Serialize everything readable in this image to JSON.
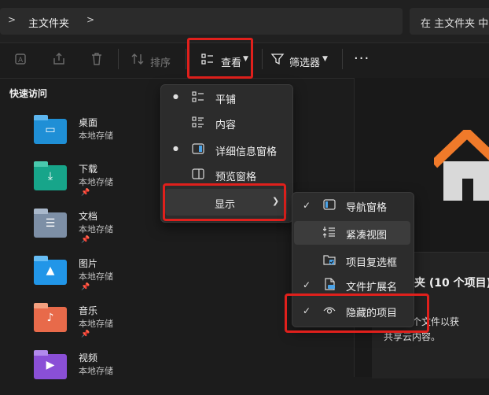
{
  "address": {
    "path_label": "主文件夹",
    "chevron": ">"
  },
  "search": {
    "placeholder": "在 主文件夹 中"
  },
  "toolbar": {
    "sort_label": "排序",
    "view_label": "查看",
    "filter_label": "筛选器",
    "more_label": "···",
    "highlight_color": "#e0201c"
  },
  "sidebar": {
    "title": "快速访问",
    "items": [
      {
        "name": "桌面",
        "sub": "本地存储",
        "color": "#1f8fd6",
        "icon": "desktop-folder-icon"
      },
      {
        "name": "下载",
        "sub": "本地存储",
        "color": "#17a58a",
        "icon": "download-folder-icon"
      },
      {
        "name": "文档",
        "sub": "本地存储",
        "color": "#7d8fa6",
        "icon": "documents-folder-icon"
      },
      {
        "name": "图片",
        "sub": "本地存储",
        "color": "#2196e8",
        "icon": "pictures-folder-icon"
      },
      {
        "name": "音乐",
        "sub": "本地存储",
        "color": "#e86a4a",
        "icon": "music-folder-icon"
      },
      {
        "name": "视频",
        "sub": "本地存储",
        "color": "#8a4fd6",
        "icon": "videos-folder-icon"
      }
    ]
  },
  "view_menu": {
    "items": [
      {
        "label": "平铺",
        "selected": true,
        "icon": "tiles-icon"
      },
      {
        "label": "内容",
        "selected": false,
        "icon": "content-icon"
      },
      {
        "label": "详细信息窗格",
        "selected": true,
        "icon": "details-pane-icon"
      },
      {
        "label": "预览窗格",
        "selected": false,
        "icon": "preview-pane-icon"
      }
    ],
    "show_label": "显示"
  },
  "show_menu": {
    "items": [
      {
        "label": "导航窗格",
        "checked": true,
        "icon": "navigation-pane-icon"
      },
      {
        "label": "紧凑视图",
        "checked": false,
        "icon": "compact-view-icon"
      },
      {
        "label": "项目复选框",
        "checked": false,
        "icon": "item-checkbox-icon"
      },
      {
        "label": "文件扩展名",
        "checked": true,
        "icon": "file-extension-icon"
      },
      {
        "label": "隐藏的项目",
        "checked": true,
        "icon": "hidden-items-icon"
      }
    ]
  },
  "preview": {
    "title": "夹 (10 个项目)",
    "desc_line1": "选择单个文件以获",
    "desc_line2": "共享云内容。"
  }
}
